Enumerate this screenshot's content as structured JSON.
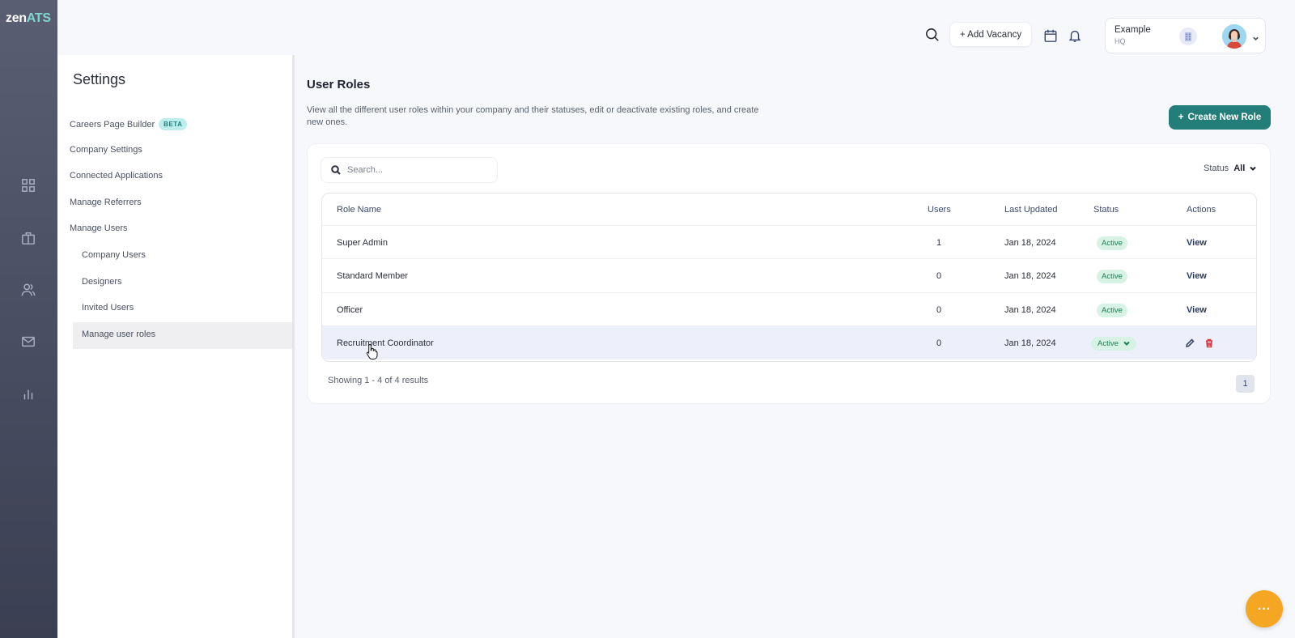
{
  "brand": {
    "logo_prefix": "zen",
    "logo_suffix": "ATS"
  },
  "rail": {
    "icons": [
      "dashboard-icon",
      "briefcase-icon",
      "users-icon",
      "mail-icon",
      "reports-icon"
    ]
  },
  "header": {
    "add_vacancy_label": "+ Add Vacancy",
    "company_name": "Example",
    "company_sub": "HQ"
  },
  "settings": {
    "title": "Settings",
    "items": [
      {
        "label": "Careers Page Builder",
        "badge": "BETA"
      },
      {
        "label": "Company Settings"
      },
      {
        "label": "Connected Applications"
      },
      {
        "label": "Manage Referrers"
      },
      {
        "label": "Manage Users"
      },
      {
        "label": "Company Users"
      },
      {
        "label": "Designers"
      },
      {
        "label": "Invited Users"
      },
      {
        "label": "Manage user roles"
      }
    ]
  },
  "main": {
    "title": "User Roles",
    "description": "View all the different user roles within your company and their statuses, edit or deactivate existing roles, and create new ones.",
    "create_button": "Create New Role",
    "search_placeholder": "Search...",
    "status_filter_label": "Status",
    "status_filter_value": "All"
  },
  "table": {
    "columns": [
      "Role Name",
      "Users",
      "Last Updated",
      "Status",
      "Actions"
    ],
    "rows": [
      {
        "role": "Super Admin",
        "users": "1",
        "updated": "Jan 18, 2024",
        "status": "Active",
        "action": "View"
      },
      {
        "role": "Standard Member",
        "users": "0",
        "updated": "Jan 18, 2024",
        "status": "Active",
        "action": "View"
      },
      {
        "role": "Officer",
        "users": "0",
        "updated": "Jan 18, 2024",
        "status": "Active",
        "action": "View"
      },
      {
        "role": "Recruitment Coordinator",
        "users": "0",
        "updated": "Jan 18, 2024",
        "status": "Active",
        "action": ""
      }
    ]
  },
  "pagination": {
    "summary": "Showing 1 - 4 of 4 results",
    "current_page": "1"
  },
  "colors": {
    "accent": "#237e7a",
    "rail": "#4a4e62",
    "active_badge_bg": "#d6f3e6",
    "fab": "#f5a623",
    "delete": "#d9363e"
  }
}
